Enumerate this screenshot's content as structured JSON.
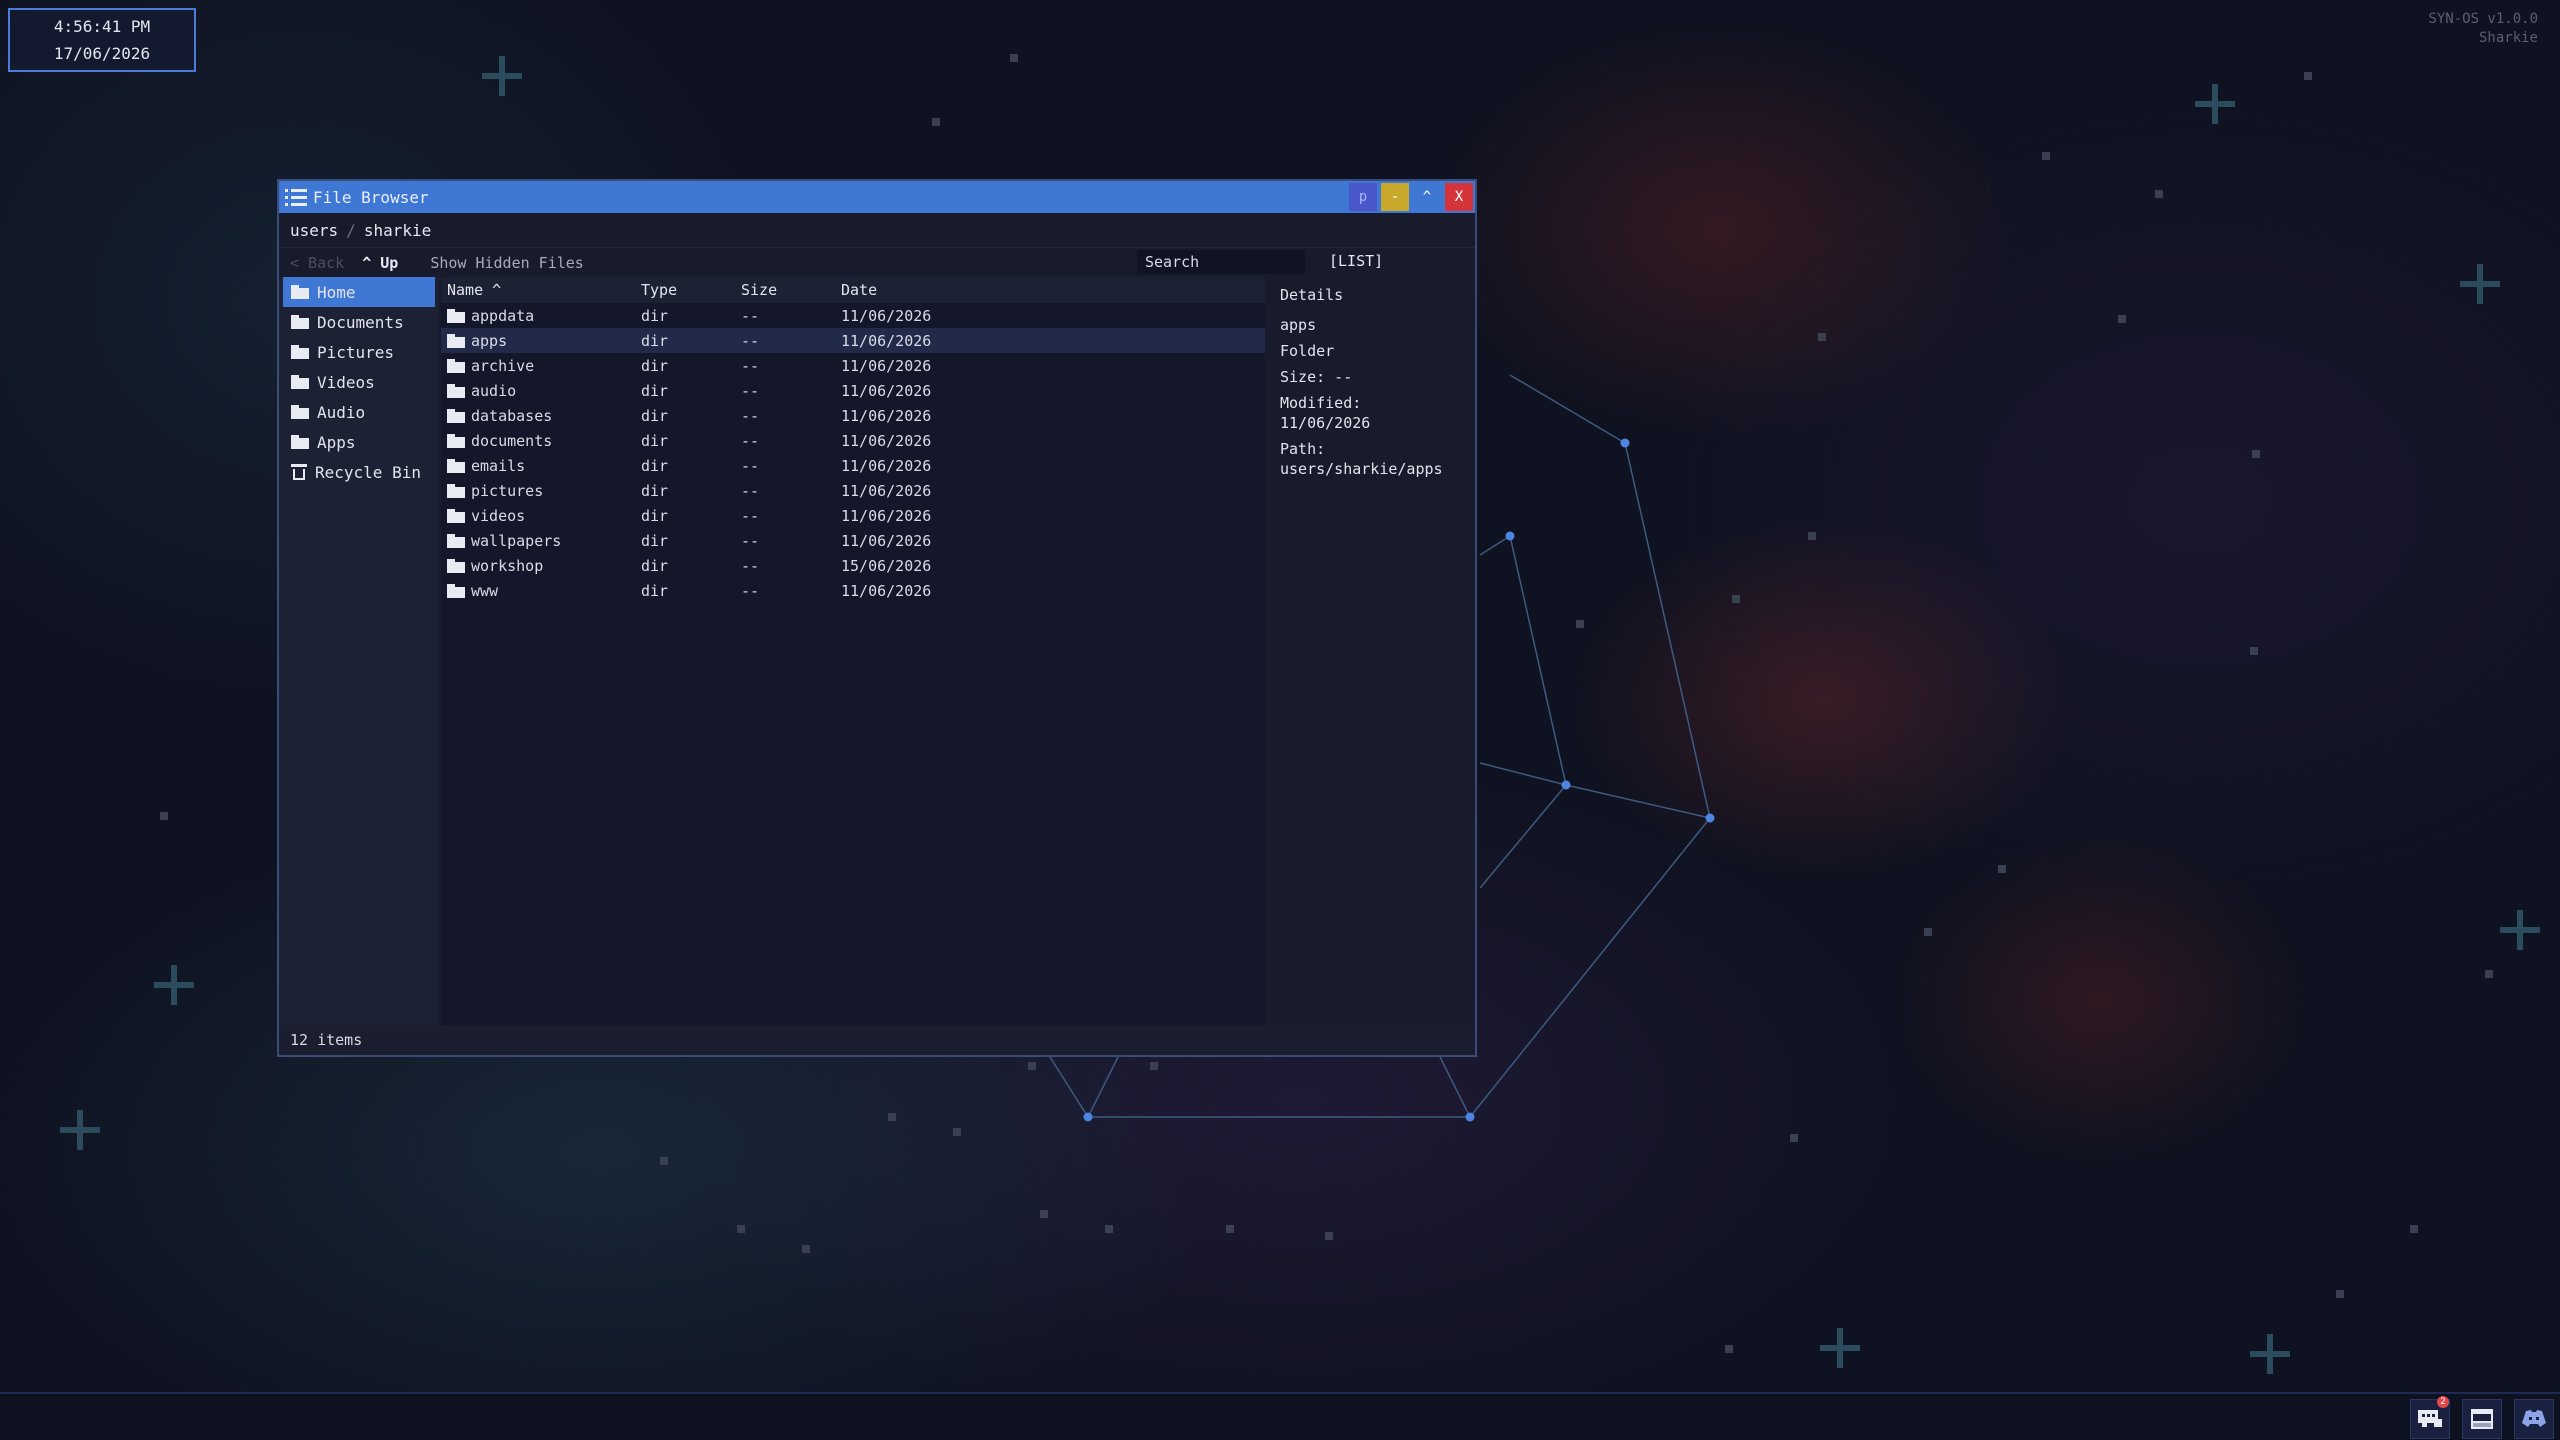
{
  "clock": {
    "time": "4:56:41 PM",
    "date": "17/06/2026"
  },
  "system": {
    "version": "SYN-OS v1.0.0",
    "user": "Sharkie"
  },
  "window": {
    "title": "File Browser",
    "buttons": {
      "p": "p",
      "minimize": "-",
      "maximize": "^",
      "close": "X"
    }
  },
  "breadcrumb": [
    "users",
    "sharkie"
  ],
  "toolbar": {
    "back": "< Back",
    "up": "^ Up",
    "show_hidden": "Show Hidden Files",
    "search_value": "Search",
    "view_mode": "[LIST]"
  },
  "sidebar": {
    "items": [
      {
        "label": "Home",
        "icon": "folder-icon",
        "active": true
      },
      {
        "label": "Documents",
        "icon": "folder-icon"
      },
      {
        "label": "Pictures",
        "icon": "folder-icon"
      },
      {
        "label": "Videos",
        "icon": "folder-icon"
      },
      {
        "label": "Audio",
        "icon": "folder-icon"
      },
      {
        "label": "Apps",
        "icon": "folder-icon"
      },
      {
        "label": "Recycle Bin",
        "icon": "trash-icon"
      }
    ]
  },
  "columns": [
    "Name ^",
    "Type",
    "Size",
    "Date"
  ],
  "files": [
    {
      "name": "appdata",
      "type": "dir",
      "size": "--",
      "date": "11/06/2026"
    },
    {
      "name": "apps",
      "type": "dir",
      "size": "--",
      "date": "11/06/2026",
      "selected": true
    },
    {
      "name": "archive",
      "type": "dir",
      "size": "--",
      "date": "11/06/2026"
    },
    {
      "name": "audio",
      "type": "dir",
      "size": "--",
      "date": "11/06/2026"
    },
    {
      "name": "databases",
      "type": "dir",
      "size": "--",
      "date": "11/06/2026"
    },
    {
      "name": "documents",
      "type": "dir",
      "size": "--",
      "date": "11/06/2026"
    },
    {
      "name": "emails",
      "type": "dir",
      "size": "--",
      "date": "11/06/2026"
    },
    {
      "name": "pictures",
      "type": "dir",
      "size": "--",
      "date": "11/06/2026"
    },
    {
      "name": "videos",
      "type": "dir",
      "size": "--",
      "date": "11/06/2026"
    },
    {
      "name": "wallpapers",
      "type": "dir",
      "size": "--",
      "date": "11/06/2026"
    },
    {
      "name": "workshop",
      "type": "dir",
      "size": "--",
      "date": "15/06/2026"
    },
    {
      "name": "www",
      "type": "dir",
      "size": "--",
      "date": "11/06/2026"
    }
  ],
  "details": {
    "heading": "Details",
    "name": "apps",
    "kind": "Folder",
    "size": "Size: --",
    "modified_label": "Modified:",
    "modified_value": "11/06/2026",
    "path_label": "Path:",
    "path_value": "users/sharkie/apps"
  },
  "status": {
    "items": "12 items"
  },
  "taskbar": {
    "icons": [
      "chat-icon",
      "window-icon",
      "discord-icon"
    ],
    "badge": "2"
  },
  "colors": {
    "accent": "#3f78d4",
    "minimize": "#c9a92b",
    "close": "#d4343a",
    "p_button": "#4a58c9"
  }
}
